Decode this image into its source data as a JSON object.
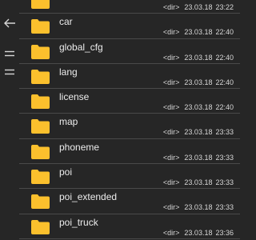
{
  "colors": {
    "background": "#262626",
    "divider": "#4a4a4a",
    "folder": "#fbc02d",
    "text": "#ececec"
  },
  "sidebar": {
    "icons": [
      "back-arrow-icon",
      "menu-icon",
      "menu-icon"
    ]
  },
  "files": [
    {
      "name": "",
      "type": "<dir>",
      "date": "23.03.18",
      "time": "23:22"
    },
    {
      "name": "car",
      "type": "<dir>",
      "date": "23.03.18",
      "time": "22:40"
    },
    {
      "name": "global_cfg",
      "type": "<dir>",
      "date": "23.03.18",
      "time": "22:40"
    },
    {
      "name": "lang",
      "type": "<dir>",
      "date": "23.03.18",
      "time": "22:40"
    },
    {
      "name": "license",
      "type": "<dir>",
      "date": "23.03.18",
      "time": "22:40"
    },
    {
      "name": "map",
      "type": "<dir>",
      "date": "23.03.18",
      "time": "23:33"
    },
    {
      "name": "phoneme",
      "type": "<dir>",
      "date": "23.03.18",
      "time": "23:33"
    },
    {
      "name": "poi",
      "type": "<dir>",
      "date": "23.03.18",
      "time": "23:33"
    },
    {
      "name": "poi_extended",
      "type": "<dir>",
      "date": "23.03.18",
      "time": "23:33"
    },
    {
      "name": "poi_truck",
      "type": "<dir>",
      "date": "23.03.18",
      "time": "23:36"
    }
  ]
}
